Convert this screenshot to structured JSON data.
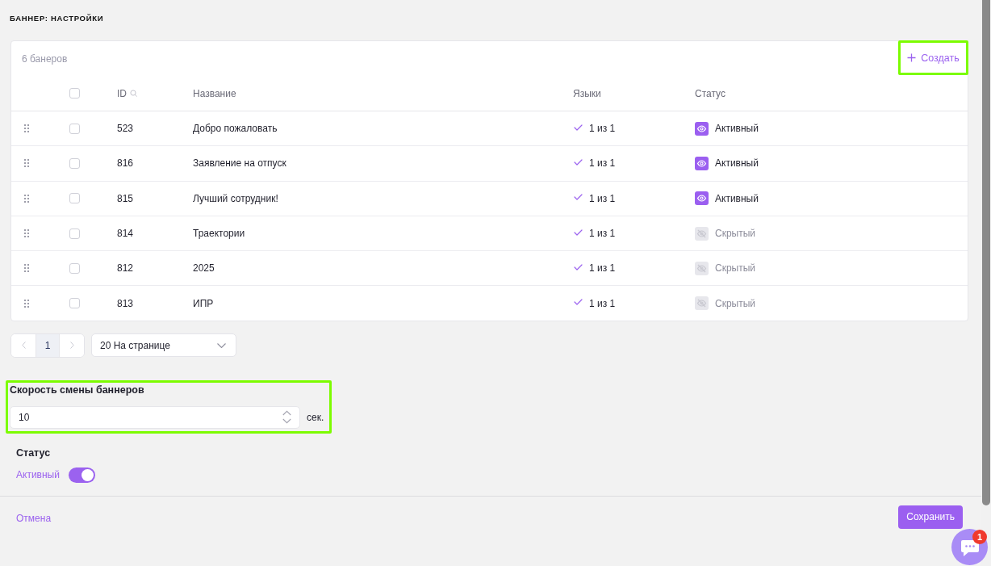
{
  "page": {
    "title": "БАННЕР: НАСТРОЙКИ"
  },
  "table": {
    "count_label": "6 банеров",
    "create": {
      "label": "Создать",
      "highlighted": true
    },
    "select_all": {
      "checked": false
    },
    "columns": [
      "ID",
      "Название",
      "Языки",
      "Статус"
    ],
    "rows": [
      {
        "checked": false,
        "id": "523",
        "name": "Добро пожаловать",
        "languages": "1 из 1",
        "status": {
          "kind": "active",
          "label": "Активный"
        }
      },
      {
        "checked": false,
        "id": "816",
        "name": "Заявление на отпуск",
        "languages": "1 из 1",
        "status": {
          "kind": "active",
          "label": "Активный"
        }
      },
      {
        "checked": false,
        "id": "815",
        "name": "Лучший сотрудник!",
        "languages": "1 из 1",
        "status": {
          "kind": "active",
          "label": "Активный"
        }
      },
      {
        "checked": false,
        "id": "814",
        "name": "Траектории",
        "languages": "1 из 1",
        "status": {
          "kind": "hidden",
          "label": "Скрытый"
        }
      },
      {
        "checked": false,
        "id": "812",
        "name": "2025",
        "languages": "1 из 1",
        "status": {
          "kind": "hidden",
          "label": "Скрытый"
        }
      },
      {
        "checked": false,
        "id": "813",
        "name": "ИПР",
        "languages": "1 из 1",
        "status": {
          "kind": "hidden",
          "label": "Скрытый"
        }
      }
    ]
  },
  "pagination": {
    "prev": {
      "disabled": true
    },
    "pages": [
      {
        "label": "1",
        "selected": true
      }
    ],
    "next": {
      "disabled": true
    },
    "per_page": "20 На странице"
  },
  "speed": {
    "label": "Скорость смены баннеров",
    "value": "10",
    "unit": "сек.",
    "highlighted": true
  },
  "status": {
    "title": "Статус",
    "label": "Активный",
    "on": true
  },
  "footer": {
    "cancel": "Отмена",
    "save": "Сохранить"
  },
  "chat": {
    "badge": "1"
  }
}
